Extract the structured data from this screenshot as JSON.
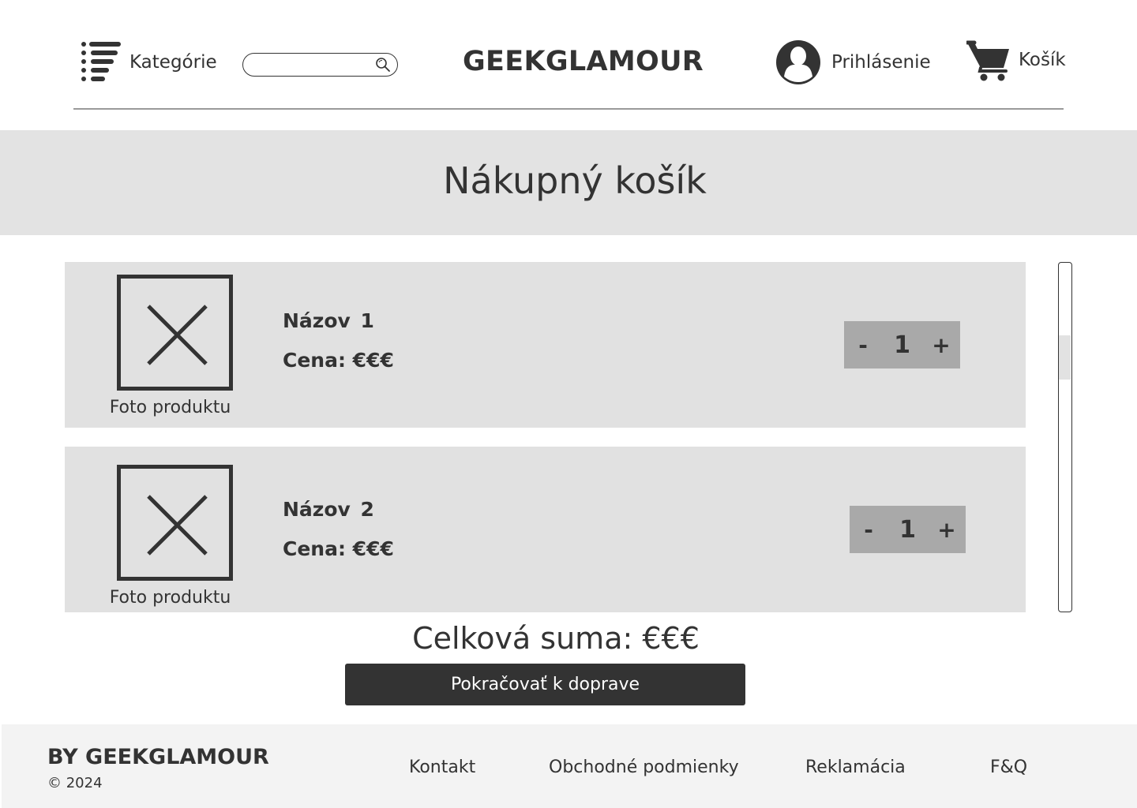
{
  "header": {
    "categories_label": "Kategórie",
    "search_placeholder": "",
    "logo": "GEEKGLAMOUR",
    "login_label": "Prihlásenie",
    "cart_label": "Košík"
  },
  "page": {
    "title": "Nákupný košík"
  },
  "cart": {
    "items": [
      {
        "photo_label": "Foto produktu",
        "name": "Názov 1",
        "price": "Cena: €€€",
        "quantity": "1",
        "minus": "-",
        "plus": "+"
      },
      {
        "photo_label": "Foto produktu",
        "name": "Názov 2",
        "price": "Cena: €€€",
        "quantity": "1",
        "minus": "-",
        "plus": "+"
      }
    ],
    "total": "Celková suma: €€€",
    "checkout_label": "Pokračovať k doprave"
  },
  "footer": {
    "brand": "BY GEEKGLAMOUR",
    "copyright": "© 2024",
    "links": [
      "Kontakt",
      "Obchodné podmienky",
      "Reklamácia",
      "F&Q"
    ]
  },
  "icons": {
    "categories": "list-menu-icon",
    "search": "search-icon",
    "login": "user-avatar-icon",
    "cart": "shopping-cart-icon",
    "photo_placeholder": "image-placeholder-x-icon"
  },
  "colors": {
    "text": "#333333",
    "banner_bg": "#e3e3e3",
    "item_bg": "#e1e1e1",
    "stepper_bg": "#a9a9a9",
    "button_bg": "#333333",
    "footer_bg": "#f3f3f3"
  }
}
